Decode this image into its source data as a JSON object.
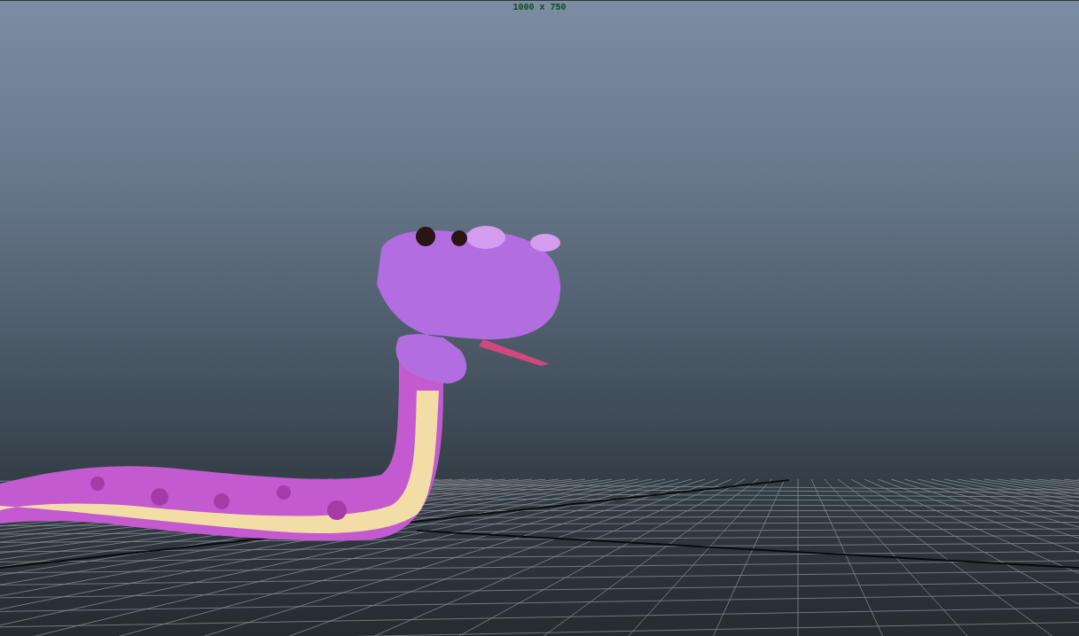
{
  "viewport": {
    "resolution_label": "1000 x 750"
  }
}
